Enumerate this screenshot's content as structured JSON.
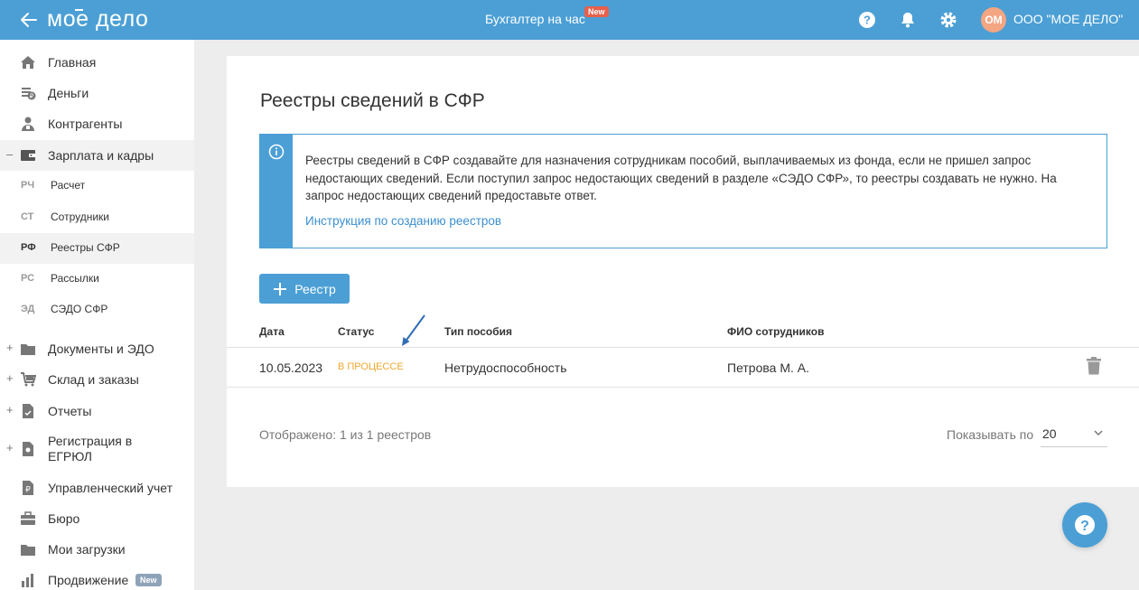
{
  "header": {
    "logo": "мое дело",
    "accountant_label": "Бухгалтер на час",
    "new_badge": "New",
    "avatar_initials": "ОМ",
    "org_name": "ООО \"МОЕ ДЕЛО\""
  },
  "sidebar": {
    "items": [
      {
        "label": "Главная",
        "icon": "home-icon"
      },
      {
        "label": "Деньги",
        "icon": "money-icon"
      },
      {
        "label": "Контрагенты",
        "icon": "contractors-icon"
      },
      {
        "label": "Зарплата и кадры",
        "icon": "wallet-icon",
        "toggle": "–"
      },
      {
        "label": "Документы и ЭДО",
        "icon": "folder-icon",
        "toggle": "+"
      },
      {
        "label": "Склад и заказы",
        "icon": "warehouse-icon",
        "toggle": "+"
      },
      {
        "label": "Отчеты",
        "icon": "report-icon",
        "toggle": "+"
      },
      {
        "label": "Регистрация в ЕГРЮЛ",
        "icon": "registration-icon",
        "toggle": "+"
      },
      {
        "label": "Управленческий учет",
        "icon": "ruble-doc-icon"
      },
      {
        "label": "Бюро",
        "icon": "briefcase-icon"
      },
      {
        "label": "Мои загрузки",
        "icon": "folder-icon"
      },
      {
        "label": "Продвижение",
        "icon": "chart-icon",
        "badge": "New"
      }
    ],
    "sub_items": [
      {
        "abbr": "РЧ",
        "label": "Расчет"
      },
      {
        "abbr": "СТ",
        "label": "Сотрудники"
      },
      {
        "abbr": "РФ",
        "label": "Реестры СФР"
      },
      {
        "abbr": "РС",
        "label": "Рассылки"
      },
      {
        "abbr": "ЭД",
        "label": "СЭДО СФР"
      }
    ]
  },
  "main": {
    "title": "Реестры сведений в СФР",
    "info_text": "Реестры сведений в СФР создавайте для назначения сотрудникам пособий, выплачиваемых из фонда, если не пришел запрос недостающих сведений. Если поступил запрос недостающих сведений в разделе «СЭДО СФР», то реестры создавать не нужно. На запрос недостающих сведений предоставьте ответ.",
    "info_link": "Инструкция по созданию реестров",
    "add_button": "Реестр",
    "columns": [
      "Дата",
      "Статус",
      "Тип пособия",
      "ФИО сотрудников"
    ],
    "rows": [
      {
        "date": "10.05.2023",
        "status": "В ПРОЦЕССЕ",
        "type": "Нетрудоспособность",
        "employees": "Петрова М. А."
      }
    ],
    "footer_text": "Отображено: 1 из 1 реестров",
    "per_page_label": "Показывать по",
    "per_page_value": "20"
  },
  "colors": {
    "accent": "#4b9fd5",
    "status_in_progress": "#f0a830",
    "new_badge": "#e8604c"
  }
}
